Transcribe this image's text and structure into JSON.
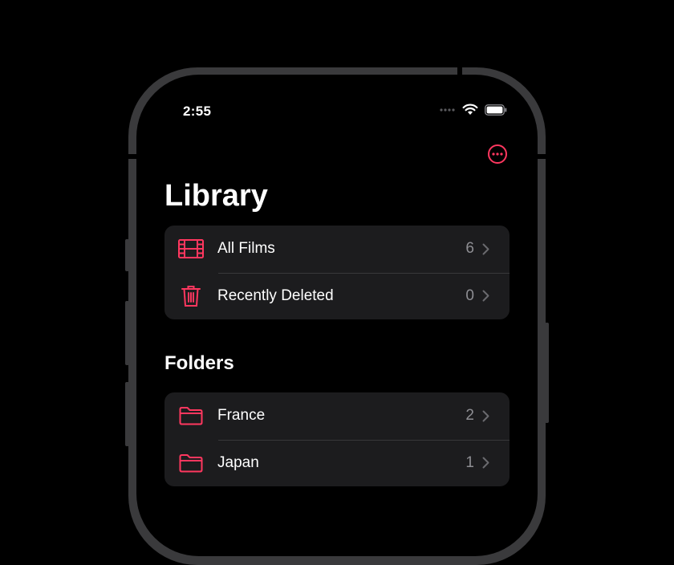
{
  "status_bar": {
    "time": "2:55"
  },
  "header": {
    "title": "Library",
    "more_icon": "ellipsis-circle-icon"
  },
  "library_items": [
    {
      "label": "All Films",
      "count": "6",
      "icon": "film-icon"
    },
    {
      "label": "Recently Deleted",
      "count": "0",
      "icon": "trash-icon"
    }
  ],
  "folders_section": {
    "title": "Folders",
    "items": [
      {
        "label": "France",
        "count": "2",
        "icon": "folder-icon"
      },
      {
        "label": "Japan",
        "count": "1",
        "icon": "folder-icon"
      }
    ]
  },
  "colors": {
    "accent": "#ff375f",
    "background": "#000000",
    "grouped_cell": "#1c1c1e",
    "secondary_text": "#8e8e93",
    "frame": "#3a3a3c"
  }
}
